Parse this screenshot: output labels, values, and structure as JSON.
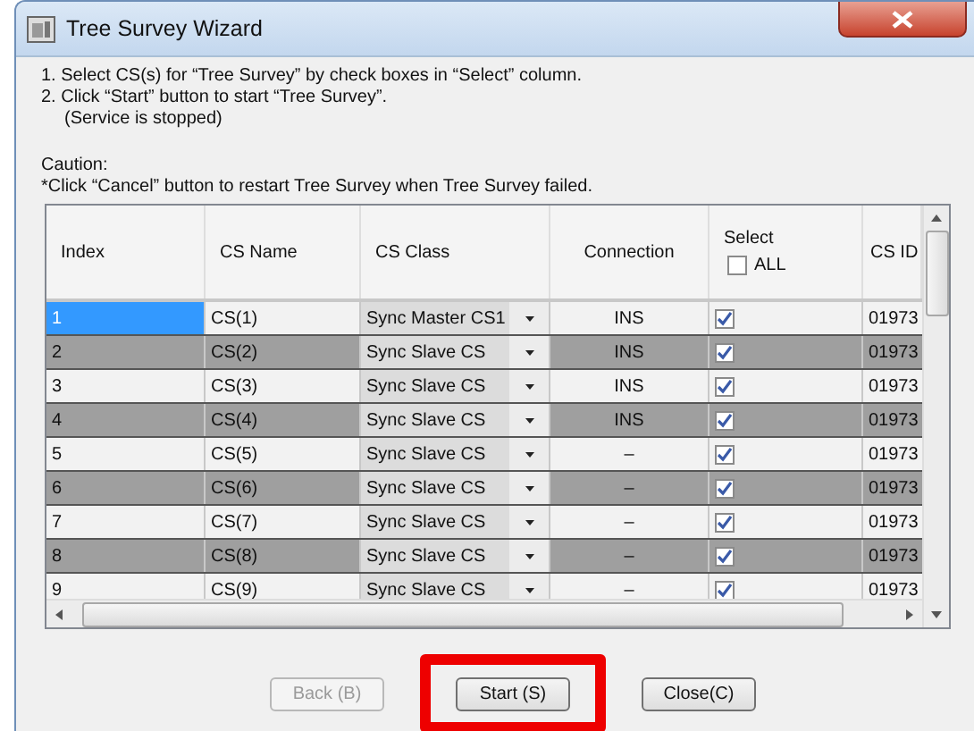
{
  "window": {
    "title": "Tree Survey Wizard"
  },
  "instructions": [
    "1. Select CS(s) for “Tree Survey” by check boxes in “Select” column.",
    "2. Click “Start” button to start “Tree Survey”.",
    "(Service is stopped)"
  ],
  "caution": {
    "heading": "Caution:",
    "text": "*Click “Cancel” button to restart Tree Survey when Tree Survey failed."
  },
  "table": {
    "columns": [
      "Index",
      "CS Name",
      "CS Class",
      "Connection",
      "Select",
      "CS ID"
    ],
    "select_all": {
      "label": "ALL",
      "checked": false
    },
    "rows": [
      {
        "index": "1",
        "name": "CS(1)",
        "cs_class": "Sync Master CS1",
        "connection": "INS",
        "checked": true,
        "cs_id": "01973",
        "selected": true
      },
      {
        "index": "2",
        "name": "CS(2)",
        "cs_class": "Sync Slave CS",
        "connection": "INS",
        "checked": true,
        "cs_id": "01973",
        "selected": false
      },
      {
        "index": "3",
        "name": "CS(3)",
        "cs_class": "Sync Slave CS",
        "connection": "INS",
        "checked": true,
        "cs_id": "01973",
        "selected": false
      },
      {
        "index": "4",
        "name": "CS(4)",
        "cs_class": "Sync Slave CS",
        "connection": "INS",
        "checked": true,
        "cs_id": "01973",
        "selected": false
      },
      {
        "index": "5",
        "name": "CS(5)",
        "cs_class": "Sync Slave CS",
        "connection": "–",
        "checked": true,
        "cs_id": "01973",
        "selected": false
      },
      {
        "index": "6",
        "name": "CS(6)",
        "cs_class": "Sync Slave CS",
        "connection": "–",
        "checked": true,
        "cs_id": "01973",
        "selected": false
      },
      {
        "index": "7",
        "name": "CS(7)",
        "cs_class": "Sync Slave CS",
        "connection": "–",
        "checked": true,
        "cs_id": "01973",
        "selected": false
      },
      {
        "index": "8",
        "name": "CS(8)",
        "cs_class": "Sync Slave CS",
        "connection": "–",
        "checked": true,
        "cs_id": "01973",
        "selected": false
      },
      {
        "index": "9",
        "name": "CS(9)",
        "cs_class": "Sync Slave CS",
        "connection": "–",
        "checked": true,
        "cs_id": "01973",
        "selected": false
      }
    ]
  },
  "buttons": [
    {
      "label": "Back (B)",
      "disabled": true,
      "highlighted": false
    },
    {
      "label": "Start (S)",
      "disabled": false,
      "highlighted": true
    },
    {
      "label": "Close(C)",
      "disabled": false,
      "highlighted": false
    }
  ]
}
